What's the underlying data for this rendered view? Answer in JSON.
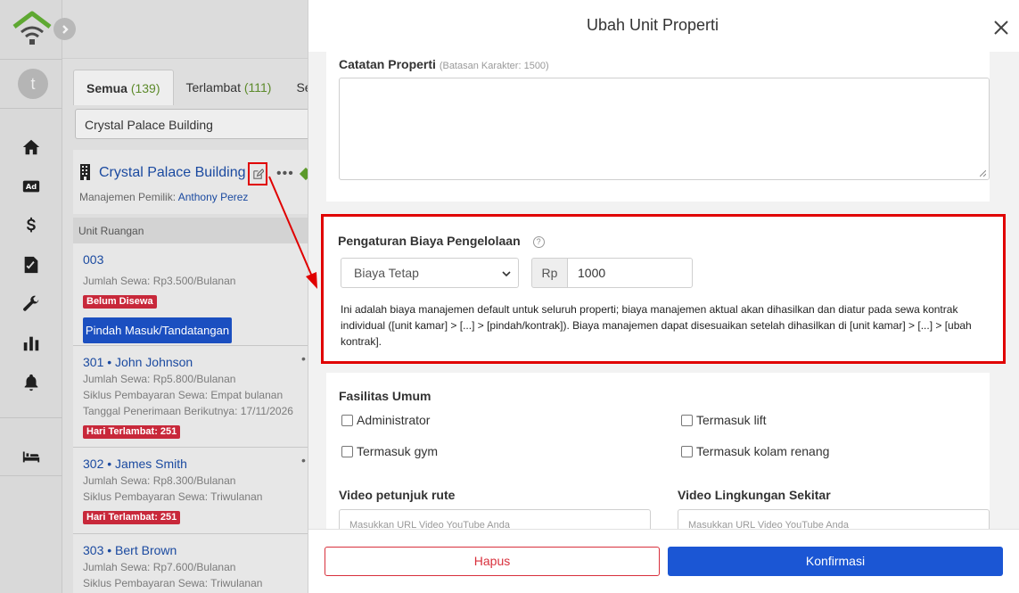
{
  "sidebar": {
    "avatar_initial": "t",
    "icons": [
      "home-icon",
      "ad-icon",
      "dollar-icon",
      "contract-icon",
      "wrench-icon",
      "bar-chart-icon",
      "bell-icon",
      "bed-icon"
    ],
    "ad_label": "Ad"
  },
  "tabs": [
    {
      "label": "Semua",
      "count": "(139)"
    },
    {
      "label": "Terlambat",
      "count": "(111)"
    },
    {
      "label": "Se"
    }
  ],
  "search": {
    "value": "Crystal Palace Building"
  },
  "building": {
    "name": "Crystal Palace Building",
    "owner_label": "Manajemen Pemilik:",
    "owner_name": "Anthony Perez"
  },
  "units_header": "Unit Ruangan",
  "units": [
    {
      "name": "003",
      "lines": [
        "Jumlah Sewa: Rp3.500/Bulanan"
      ],
      "badge": "Belum Disewa",
      "button": "Pindah Masuk/Tandatangan"
    },
    {
      "name": "301 • John Johnson",
      "lines": [
        "Jumlah Sewa: Rp5.800/Bulanan",
        "Siklus Pembayaran Sewa: Empat bulanan",
        "Tanggal Penerimaan Berikutnya:  17/11/2026"
      ],
      "badge": "Hari Terlambat: 251"
    },
    {
      "name": "302 • James Smith",
      "lines": [
        "Jumlah Sewa: Rp8.300/Bulanan",
        "Siklus Pembayaran Sewa: Triwulanan"
      ],
      "badge": "Hari Terlambat: 251"
    },
    {
      "name": "303 • Bert Brown",
      "lines": [
        "Jumlah Sewa: Rp7.600/Bulanan",
        "Siklus Pembayaran Sewa: Triwulanan"
      ]
    }
  ],
  "modal": {
    "title": "Ubah Unit Properti",
    "notes": {
      "label": "Catatan Properti",
      "hint": "(Batasan Karakter: 1500)"
    },
    "fee": {
      "title": "Pengaturan Biaya Pengelolaan",
      "help": "?",
      "type_selected": "Biaya Tetap",
      "currency": "Rp",
      "amount": "1000",
      "description": "Ini adalah biaya manajemen default untuk seluruh properti; biaya manajemen aktual akan dihasilkan dan diatur pada sewa kontrak individual ([unit kamar] > [...] > [pindah/kontrak]). Biaya manajemen dapat disesuaikan setelah dihasilkan di [unit kamar] > [...] > [ubah kontrak]."
    },
    "facilities": {
      "title": "Fasilitas Umum",
      "items": [
        "Administrator",
        "Termasuk lift",
        "Termasuk gym",
        "Termasuk kolam renang"
      ]
    },
    "video_route": {
      "label": "Video petunjuk rute",
      "placeholder": "Masukkan URL Video YouTube Anda"
    },
    "video_env": {
      "label": "Video Lingkungan Sekitar",
      "placeholder": "Masukkan URL Video YouTube Anda"
    },
    "delete_label": "Hapus",
    "confirm_label": "Konfirmasi"
  },
  "colors": {
    "accent": "#1b56d4",
    "danger": "#d8303c",
    "highlight": "#e00000",
    "late_badge": "#c8283a"
  }
}
